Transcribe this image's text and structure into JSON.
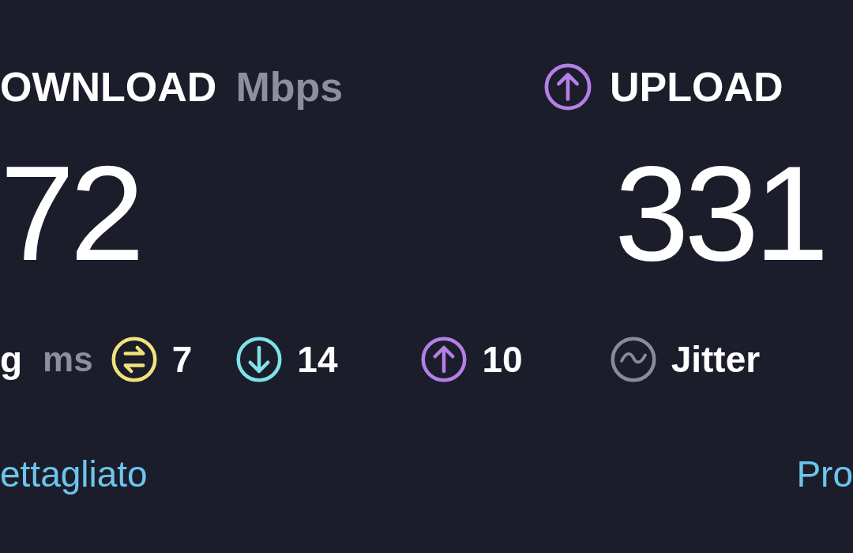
{
  "download": {
    "label": "OWNLOAD",
    "unit": "Mbps",
    "value": "72"
  },
  "upload": {
    "label": "UPLOAD",
    "value": "331"
  },
  "ping": {
    "label": "g",
    "unit": "ms",
    "stats": [
      {
        "kind": "idle",
        "value": "7"
      },
      {
        "kind": "download",
        "value": "14"
      },
      {
        "kind": "upload",
        "value": "10"
      }
    ]
  },
  "jitter": {
    "label": "Jitter"
  },
  "links": [
    "ettagliato",
    "Pro"
  ]
}
